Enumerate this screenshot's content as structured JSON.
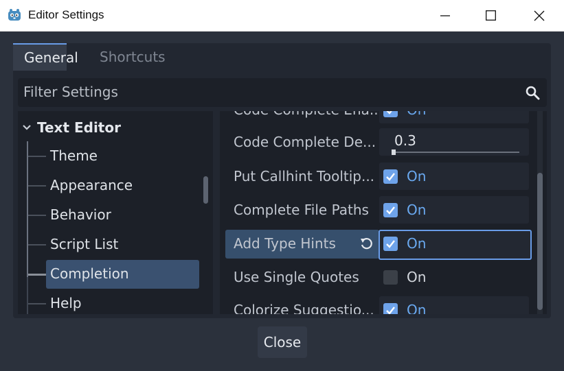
{
  "window": {
    "title": "Editor Settings",
    "icon": "godot-icon"
  },
  "tabs": [
    {
      "label": "General"
    },
    {
      "label": "Shortcuts"
    }
  ],
  "filter": {
    "placeholder": "Filter Settings"
  },
  "tree": {
    "section": "Text Editor",
    "items": [
      {
        "label": "Theme"
      },
      {
        "label": "Appearance"
      },
      {
        "label": "Behavior"
      },
      {
        "label": "Script List"
      },
      {
        "label": "Completion",
        "selected": true
      },
      {
        "label": "Help"
      }
    ]
  },
  "properties": [
    {
      "name": "Code Complete Ena...",
      "type": "checkbox",
      "checked": true,
      "value": "On"
    },
    {
      "name": "Code Complete De...",
      "type": "slider",
      "value": "0.3",
      "level": 0.03
    },
    {
      "name": "Put Callhint Tooltip...",
      "type": "checkbox",
      "checked": true,
      "value": "On"
    },
    {
      "name": "Complete File Paths",
      "type": "checkbox",
      "checked": true,
      "value": "On"
    },
    {
      "name": "Add Type Hints",
      "type": "checkbox",
      "checked": true,
      "value": "On",
      "highlighted": true,
      "revert_icon": "revert-icon"
    },
    {
      "name": "Use Single Quotes",
      "type": "checkbox",
      "checked": false,
      "value": "On"
    },
    {
      "name": "Colorize Suggestio...",
      "type": "checkbox",
      "checked": true,
      "value": "On"
    }
  ],
  "footer": {
    "close_label": "Close"
  },
  "colors": {
    "accent": "#699ce8",
    "panel": "#222731",
    "selection": "#3a5170",
    "checkbox_on": "#6ea3ea"
  }
}
